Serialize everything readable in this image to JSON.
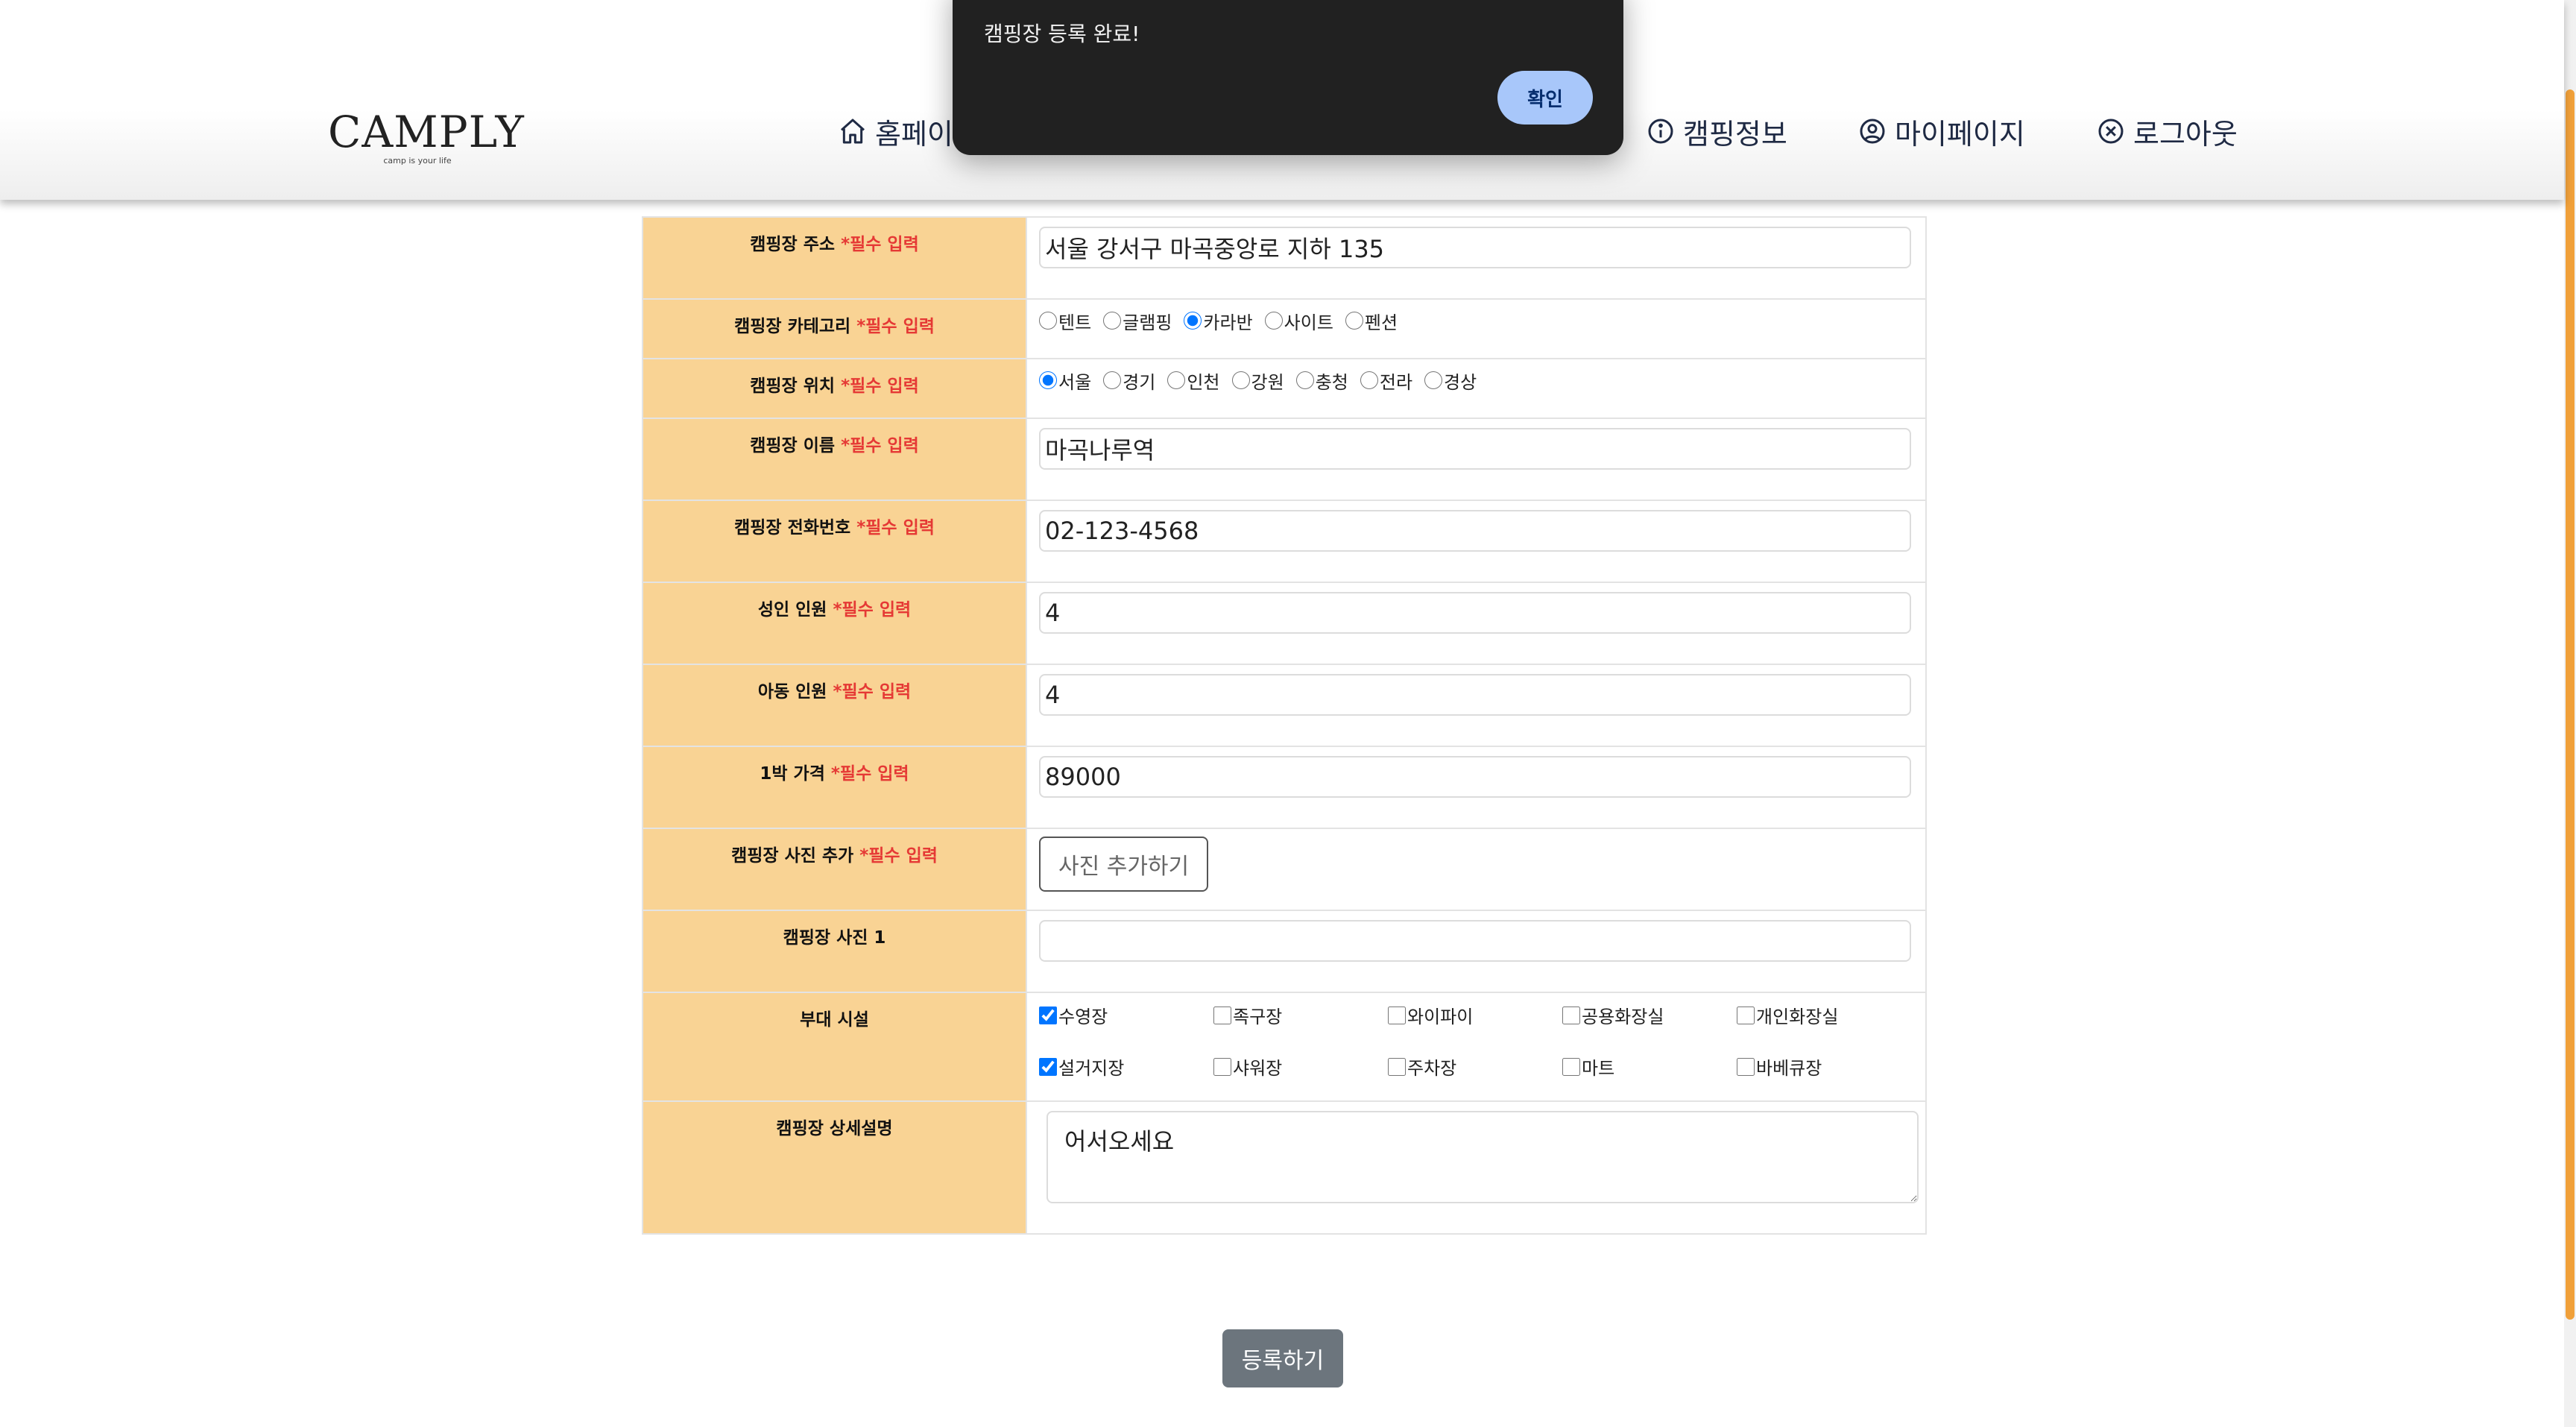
{
  "header": {
    "logo": "CAMPLY",
    "logo_tagline": "camp is your life",
    "nav": {
      "home": "홈페이지",
      "camping_info": "캠핑정보",
      "mypage": "마이페이지",
      "logout": "로그아웃"
    }
  },
  "dialog": {
    "message": "캠핑장 등록 완료!",
    "ok_label": "확인"
  },
  "form": {
    "required_mark": "*필수 입력",
    "address": {
      "label": "캠핑장 주소",
      "value": "서울 강서구 마곡중앙로 지하 135"
    },
    "category": {
      "label": "캠핑장 카테고리",
      "options": [
        "텐트",
        "글램핑",
        "카라반",
        "사이트",
        "펜션"
      ],
      "selected": "카라반"
    },
    "location": {
      "label": "캠핑장 위치",
      "options": [
        "서울",
        "경기",
        "인천",
        "강원",
        "충청",
        "전라",
        "경상"
      ],
      "selected": "서울"
    },
    "name": {
      "label": "캠핑장 이름",
      "value": "마곡나루역"
    },
    "phone": {
      "label": "캠핑장 전화번호",
      "value": "02-123-4568"
    },
    "adults": {
      "label": "성인 인원",
      "value": "4"
    },
    "children": {
      "label": "아동 인원",
      "value": "4"
    },
    "price": {
      "label": "1박 가격",
      "value": "89000"
    },
    "photo_add": {
      "label": "캠핑장 사진 추가",
      "button": "사진 추가하기"
    },
    "photo1": {
      "label": "캠핑장 사진 1",
      "value": ""
    },
    "amenities": {
      "label": "부대 시설",
      "items": [
        {
          "name": "수영장",
          "checked": true
        },
        {
          "name": "족구장",
          "checked": false
        },
        {
          "name": "와이파이",
          "checked": false
        },
        {
          "name": "공용화장실",
          "checked": false
        },
        {
          "name": "개인화장실",
          "checked": false
        },
        {
          "name": "설거지장",
          "checked": true
        },
        {
          "name": "샤워장",
          "checked": false
        },
        {
          "name": "주차장",
          "checked": false
        },
        {
          "name": "마트",
          "checked": false
        },
        {
          "name": "바베큐장",
          "checked": false
        }
      ]
    },
    "description": {
      "label": "캠핑장 상세설명",
      "value": "어서오세요"
    }
  },
  "submit_label": "등록하기",
  "colors": {
    "label_bg": "#f9d394",
    "required": "#e53935",
    "dialog_bg": "#212121",
    "dialog_button": "#a8c7fa",
    "scrollbar": "#f0a03a",
    "submit_bg": "#6c757d"
  }
}
